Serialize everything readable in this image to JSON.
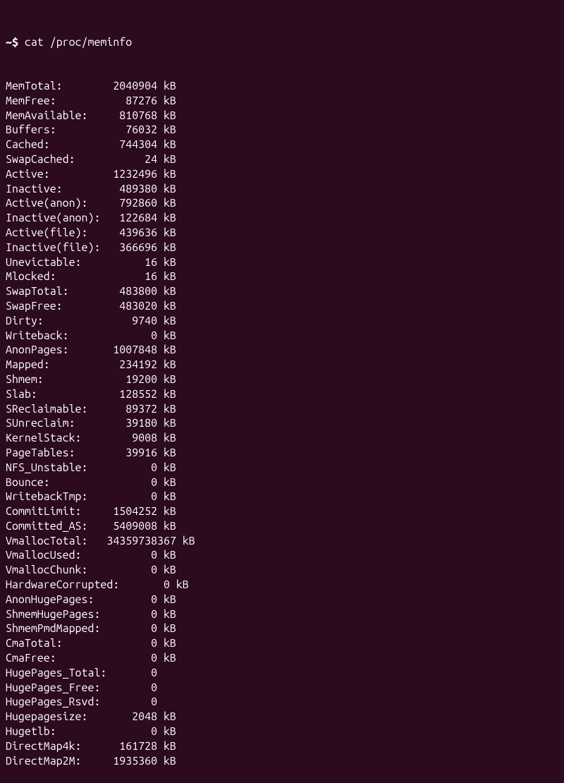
{
  "prompt": "~$",
  "command": "cat /proc/meminfo",
  "entries": [
    {
      "label": "MemTotal:",
      "value": "2040904",
      "unit": "kB"
    },
    {
      "label": "MemFree:",
      "value": "87276",
      "unit": "kB"
    },
    {
      "label": "MemAvailable:",
      "value": "810768",
      "unit": "kB"
    },
    {
      "label": "Buffers:",
      "value": "76032",
      "unit": "kB"
    },
    {
      "label": "Cached:",
      "value": "744304",
      "unit": "kB"
    },
    {
      "label": "SwapCached:",
      "value": "24",
      "unit": "kB"
    },
    {
      "label": "Active:",
      "value": "1232496",
      "unit": "kB"
    },
    {
      "label": "Inactive:",
      "value": "489380",
      "unit": "kB"
    },
    {
      "label": "Active(anon):",
      "value": "792860",
      "unit": "kB"
    },
    {
      "label": "Inactive(anon):",
      "value": "122684",
      "unit": "kB"
    },
    {
      "label": "Active(file):",
      "value": "439636",
      "unit": "kB"
    },
    {
      "label": "Inactive(file):",
      "value": "366696",
      "unit": "kB"
    },
    {
      "label": "Unevictable:",
      "value": "16",
      "unit": "kB"
    },
    {
      "label": "Mlocked:",
      "value": "16",
      "unit": "kB"
    },
    {
      "label": "SwapTotal:",
      "value": "483800",
      "unit": "kB"
    },
    {
      "label": "SwapFree:",
      "value": "483020",
      "unit": "kB"
    },
    {
      "label": "Dirty:",
      "value": "9740",
      "unit": "kB"
    },
    {
      "label": "Writeback:",
      "value": "0",
      "unit": "kB"
    },
    {
      "label": "AnonPages:",
      "value": "1007848",
      "unit": "kB"
    },
    {
      "label": "Mapped:",
      "value": "234192",
      "unit": "kB"
    },
    {
      "label": "Shmem:",
      "value": "19200",
      "unit": "kB"
    },
    {
      "label": "Slab:",
      "value": "128552",
      "unit": "kB"
    },
    {
      "label": "SReclaimable:",
      "value": "89372",
      "unit": "kB"
    },
    {
      "label": "SUnreclaim:",
      "value": "39180",
      "unit": "kB"
    },
    {
      "label": "KernelStack:",
      "value": "9008",
      "unit": "kB"
    },
    {
      "label": "PageTables:",
      "value": "39916",
      "unit": "kB"
    },
    {
      "label": "NFS_Unstable:",
      "value": "0",
      "unit": "kB"
    },
    {
      "label": "Bounce:",
      "value": "0",
      "unit": "kB"
    },
    {
      "label": "WritebackTmp:",
      "value": "0",
      "unit": "kB"
    },
    {
      "label": "CommitLimit:",
      "value": "1504252",
      "unit": "kB"
    },
    {
      "label": "Committed_AS:",
      "value": "5409008",
      "unit": "kB"
    },
    {
      "label": "VmallocTotal:",
      "value": "34359738367",
      "unit": "kB"
    },
    {
      "label": "VmallocUsed:",
      "value": "0",
      "unit": "kB"
    },
    {
      "label": "VmallocChunk:",
      "value": "0",
      "unit": "kB"
    },
    {
      "label": "HardwareCorrupted:",
      "value": "0",
      "unit": "kB"
    },
    {
      "label": "AnonHugePages:",
      "value": "0",
      "unit": "kB"
    },
    {
      "label": "ShmemHugePages:",
      "value": "0",
      "unit": "kB"
    },
    {
      "label": "ShmemPmdMapped:",
      "value": "0",
      "unit": "kB"
    },
    {
      "label": "CmaTotal:",
      "value": "0",
      "unit": "kB"
    },
    {
      "label": "CmaFree:",
      "value": "0",
      "unit": "kB"
    },
    {
      "label": "HugePages_Total:",
      "value": "0",
      "unit": ""
    },
    {
      "label": "HugePages_Free:",
      "value": "0",
      "unit": ""
    },
    {
      "label": "HugePages_Rsvd:",
      "value": "0",
      "unit": ""
    },
    {
      "label": "Hugepagesize:",
      "value": "2048",
      "unit": "kB"
    },
    {
      "label": "Hugetlb:",
      "value": "0",
      "unit": "kB"
    },
    {
      "label": "DirectMap4k:",
      "value": "161728",
      "unit": "kB"
    },
    {
      "label": "DirectMap2M:",
      "value": "1935360",
      "unit": "kB"
    }
  ]
}
